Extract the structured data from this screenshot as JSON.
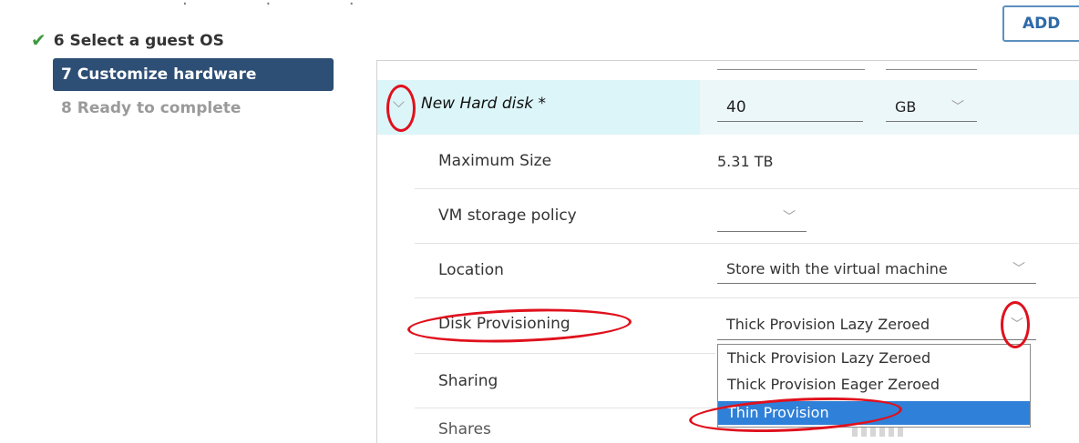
{
  "toolbar": {
    "add_label": "ADD"
  },
  "steps": [
    {
      "label": "6 Select a guest OS",
      "state": "completed"
    },
    {
      "label": "7 Customize hardware",
      "state": "active"
    },
    {
      "label": "8 Ready to complete",
      "state": "pending"
    }
  ],
  "hard_disk": {
    "title": "New Hard disk *",
    "size_value": "40",
    "size_unit": "GB"
  },
  "rows": {
    "maximum_size": {
      "label": "Maximum Size",
      "value": "5.31 TB"
    },
    "storage_policy": {
      "label": "VM storage policy",
      "value": ""
    },
    "location": {
      "label": "Location",
      "value": "Store with the virtual machine"
    },
    "disk_provisioning": {
      "label": "Disk Provisioning",
      "value": "Thick Provision Lazy Zeroed"
    },
    "sharing": {
      "label": "Sharing"
    },
    "shares": {
      "label": "Shares"
    }
  },
  "provisioning_options": [
    {
      "label": "Thick Provision Lazy Zeroed",
      "highlighted": false
    },
    {
      "label": "Thick Provision Eager Zeroed",
      "highlighted": false
    },
    {
      "label": "Thin Provision",
      "highlighted": true
    }
  ],
  "colors": {
    "active_step_bg": "#2d4e75",
    "check_green": "#3d9a3d",
    "highlight_blue": "#2f80d8",
    "annotation_red": "#e0101c",
    "disk_row_bg": "#dcf5f8"
  },
  "icons": {
    "completed_step": "check-icon",
    "toggle": "chevron-down-icon",
    "select": "chevron-down-icon"
  }
}
